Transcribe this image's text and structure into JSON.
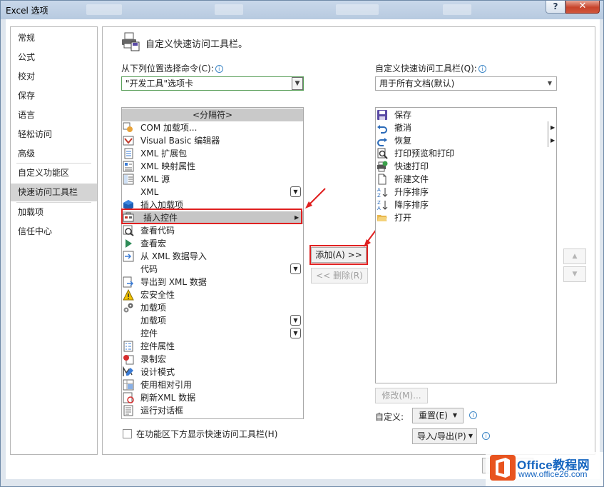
{
  "window": {
    "title": "Excel 选项",
    "help_glyph": "?",
    "close_glyph": "✕"
  },
  "sidebar": {
    "items": [
      {
        "label": "常规"
      },
      {
        "label": "公式"
      },
      {
        "label": "校对"
      },
      {
        "label": "保存"
      },
      {
        "label": "语言"
      },
      {
        "label": "轻松访问"
      },
      {
        "label": "高级"
      },
      {
        "label": "自定义功能区"
      },
      {
        "label": "快速访问工具栏",
        "selected": true
      },
      {
        "label": "加载项"
      },
      {
        "label": "信任中心"
      }
    ]
  },
  "main": {
    "title": "自定义快速访问工具栏。",
    "commands_from_label": "从下列位置选择命令(C):",
    "commands_from_value": "\"开发工具\"选项卡",
    "customize_qat_label": "自定义快速访问工具栏(Q):",
    "customize_qat_value": "用于所有文档(默认)",
    "left_list": [
      {
        "label": "<分隔符>",
        "icon": "separator"
      },
      {
        "label": "COM 加载项...",
        "icon": "com-addin-icon"
      },
      {
        "label": "Visual Basic 编辑器",
        "icon": "vba-editor-icon"
      },
      {
        "label": "XML 扩展包",
        "icon": "xml-expansion-icon"
      },
      {
        "label": "XML 映射属性",
        "icon": "xml-map-icon"
      },
      {
        "label": "XML 源",
        "icon": "xml-source-icon"
      },
      {
        "label": "XML",
        "icon": "none",
        "expand": true
      },
      {
        "label": "插入加载项",
        "icon": "insert-addin-icon"
      },
      {
        "label": "插入控件",
        "icon": "insert-control-icon",
        "submenu": true
      },
      {
        "label": "查看代码",
        "icon": "view-code-icon"
      },
      {
        "label": "查看宏",
        "icon": "view-macros-icon"
      },
      {
        "label": "从 XML 数据导入",
        "icon": "xml-import-icon"
      },
      {
        "label": "代码",
        "icon": "none",
        "expand": true
      },
      {
        "label": "导出到 XML 数据",
        "icon": "xml-export-icon"
      },
      {
        "label": "宏安全性",
        "icon": "macro-security-icon"
      },
      {
        "label": "加载项",
        "icon": "addins-icon"
      },
      {
        "label": "加载项",
        "icon": "none",
        "expand": true
      },
      {
        "label": "控件",
        "icon": "none",
        "expand": true
      },
      {
        "label": "控件属性",
        "icon": "control-properties-icon"
      },
      {
        "label": "录制宏",
        "icon": "record-macro-icon"
      },
      {
        "label": "设计模式",
        "icon": "design-mode-icon"
      },
      {
        "label": "使用相对引用",
        "icon": "relative-reference-icon"
      },
      {
        "label": "刷新XML 数据",
        "icon": "refresh-xml-icon"
      },
      {
        "label": "运行对话框",
        "icon": "run-dialog-icon"
      }
    ],
    "right_list": [
      {
        "label": "保存",
        "icon": "save-icon"
      },
      {
        "label": "撤消",
        "icon": "undo-icon",
        "submenu": true
      },
      {
        "label": "恢复",
        "icon": "redo-icon",
        "submenu": true
      },
      {
        "label": "打印预览和打印",
        "icon": "print-preview-icon"
      },
      {
        "label": "快速打印",
        "icon": "quick-print-icon"
      },
      {
        "label": "新建文件",
        "icon": "new-file-icon"
      },
      {
        "label": "升序排序",
        "icon": "sort-ascending-icon"
      },
      {
        "label": "降序排序",
        "icon": "sort-descending-icon"
      },
      {
        "label": "打开",
        "icon": "open-folder-icon"
      }
    ],
    "add_button": "添加(A) >>",
    "remove_button": "<< 删除(R)",
    "modify_button": "修改(M)...",
    "customize_label": "自定义:",
    "reset_button": "重置(E)",
    "import_export_button": "导入/导出(P)",
    "show_below_ribbon": "在功能区下方显示快速访问工具栏(H)",
    "move_up_glyph": "▲",
    "move_down_glyph": "▼"
  },
  "watermark": {
    "title": "Office教程网",
    "url": "www.office26.com"
  },
  "colors": {
    "highlight_box": "#e02020",
    "watermark_blue": "#1565c0",
    "watermark_orange": "#e8541f"
  }
}
